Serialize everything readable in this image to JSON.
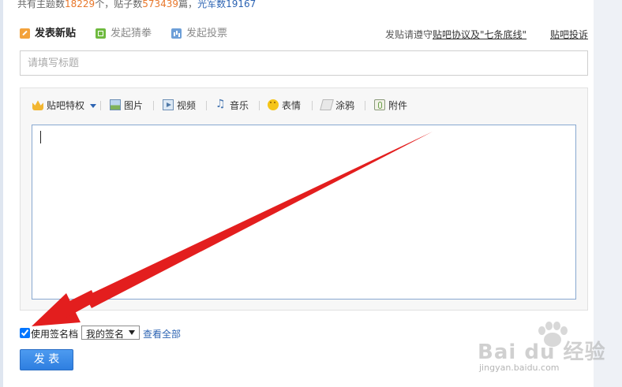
{
  "stats": {
    "topics_prefix": "共有主题数",
    "topics_count": "18229",
    "topics_unit": "个，",
    "posts_prefix": "贴子数",
    "posts_count": "573439",
    "posts_unit": "篇，",
    "members_label": "光军数",
    "members_count": "19167"
  },
  "tabs": [
    {
      "label": "发表新贴",
      "icon": "edit-icon",
      "active": true
    },
    {
      "label": "发起猜拳",
      "icon": "guess-icon",
      "active": false
    },
    {
      "label": "发起投票",
      "icon": "vote-icon",
      "active": false
    }
  ],
  "rules": {
    "prefix": "发贴请遵守",
    "agreement_link": "贴吧协议及\"七条底线\"",
    "complaint_link": "贴吧投诉"
  },
  "title_input": {
    "placeholder": "请填写标题",
    "value": ""
  },
  "toolbar": {
    "privilege": "贴吧特权",
    "image": "图片",
    "video": "视频",
    "music": "音乐",
    "emoji": "表情",
    "doodle": "涂鸦",
    "attachment": "附件"
  },
  "editor": {
    "content": ""
  },
  "signature": {
    "checked": true,
    "label": "使用签名档",
    "selected": "我的签名",
    "see_all": "查看全部"
  },
  "submit_label": "发 表",
  "watermark": {
    "brand": "Bai du 经验",
    "url": "jingyan.baidu.com"
  },
  "colors": {
    "accent_link": "#2d64b3",
    "count_orange": "#e8782c",
    "button_blue": "#3a8ae8",
    "annotation_arrow": "#e31e1e"
  }
}
